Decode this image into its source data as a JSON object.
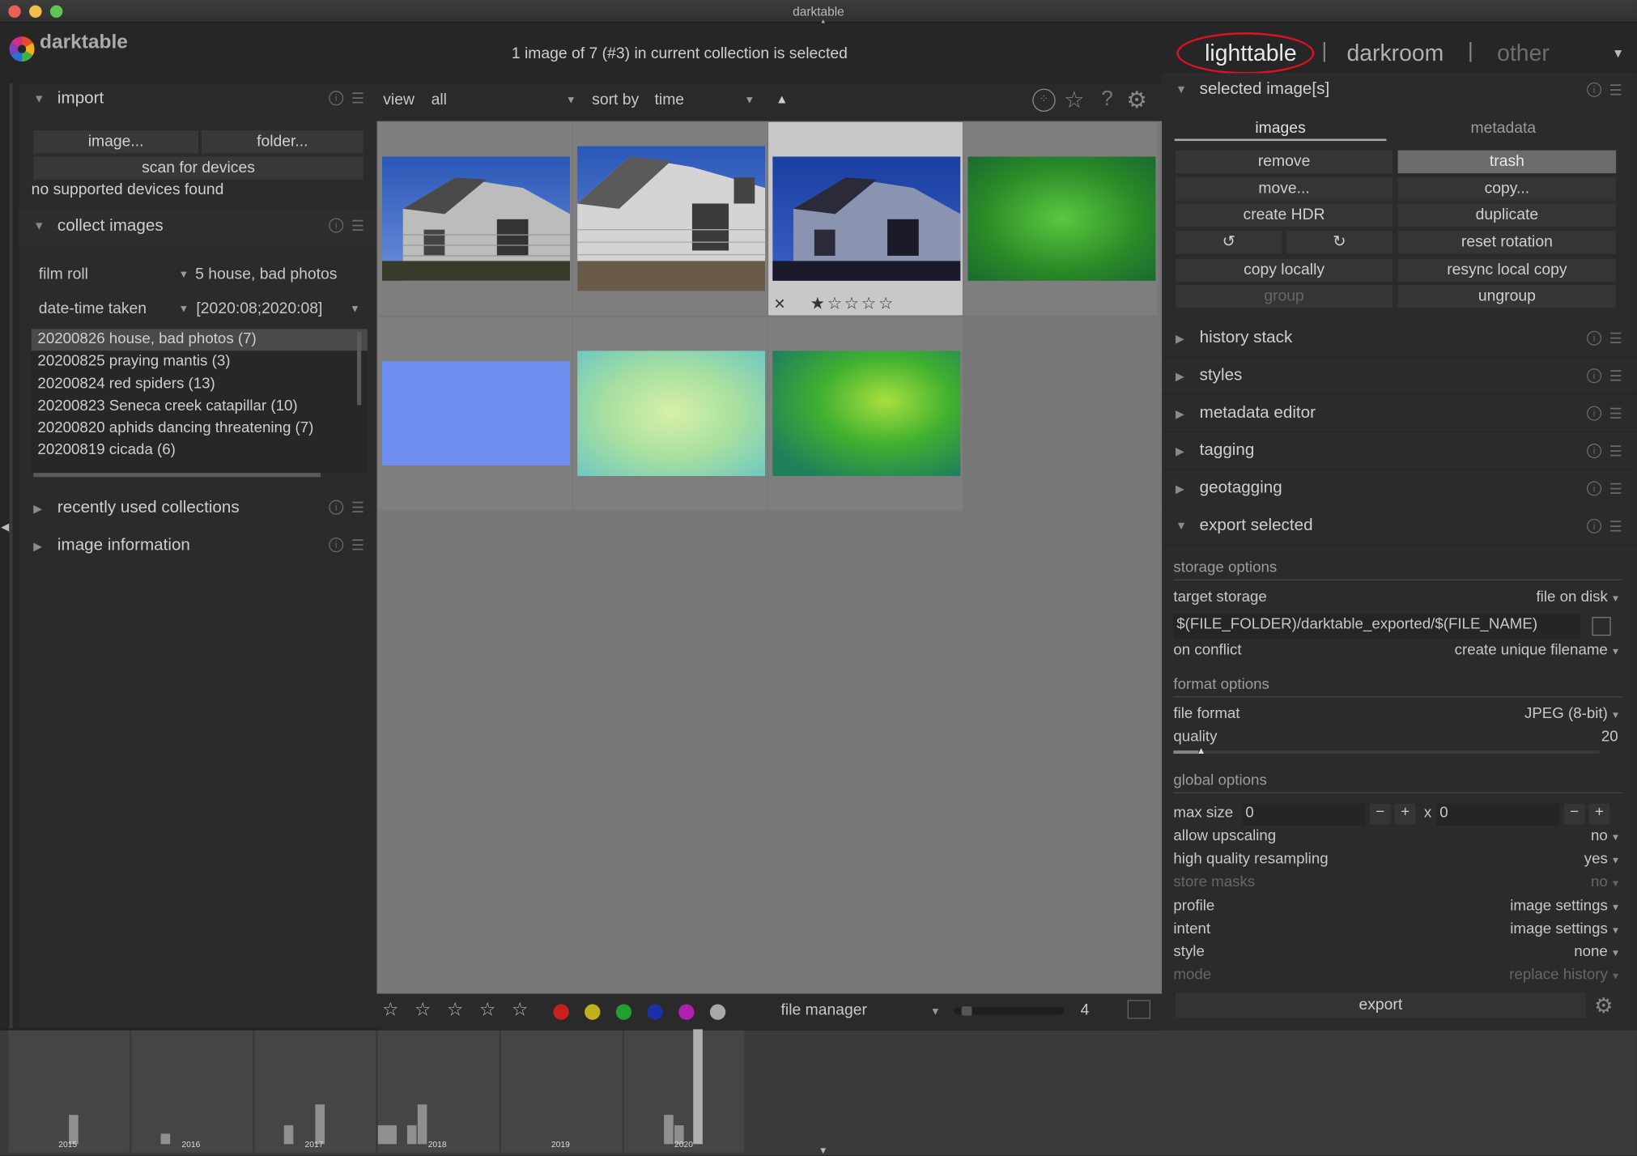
{
  "window": {
    "title": "darktable"
  },
  "app": {
    "name": "darktable"
  },
  "header": {
    "status": "1 image of 7 (#3) in current collection is selected",
    "views": [
      "lighttable",
      "darkroom",
      "other"
    ],
    "separator": "|"
  },
  "left": {
    "import": {
      "title": "import",
      "image_btn": "image...",
      "folder_btn": "folder...",
      "scan_btn": "scan for devices",
      "status": "no supported devices found"
    },
    "collect": {
      "title": "collect images",
      "rule1_key": "film roll",
      "rule1_value": "5 house, bad photos",
      "rule2_key": "date-time taken",
      "rule2_value": "[2020:08;2020:08]",
      "items": [
        "20200826 house, bad photos (7)",
        "20200825 praying mantis (3)",
        "20200824 red spiders (13)",
        "20200823 Seneca creek catapillar (10)",
        "20200820 aphids dancing threatening (7)",
        "20200819 cicada (6)"
      ]
    },
    "recent": {
      "title": "recently used collections"
    },
    "info": {
      "title": "image information"
    }
  },
  "toolbar": {
    "view_label": "view",
    "view_value": "all",
    "sort_label": "sort by",
    "sort_value": "time",
    "sort_dir": "▲"
  },
  "bottombar": {
    "layout": "file manager",
    "zoom": "4",
    "colors": [
      "#c8201e",
      "#c0b020",
      "#20a030",
      "#1a2fa8",
      "#b020b0",
      "#a8a8a8"
    ]
  },
  "right": {
    "selected": {
      "title": "selected image[s]",
      "tab_images": "images",
      "tab_metadata": "metadata",
      "buttons": {
        "remove": "remove",
        "trash": "trash",
        "move": "move...",
        "copy": "copy...",
        "create_hdr": "create HDR",
        "duplicate": "duplicate",
        "reset_rotation": "reset rotation",
        "copy_locally": "copy locally",
        "resync": "resync local copy",
        "group": "group",
        "ungroup": "ungroup"
      }
    },
    "modules": [
      "history stack",
      "styles",
      "metadata editor",
      "tagging",
      "geotagging"
    ],
    "export": {
      "title": "export selected",
      "storage_options": "storage options",
      "target_storage_label": "target storage",
      "target_storage": "file on disk",
      "path": "$(FILE_FOLDER)/darktable_exported/$(FILE_NAME)",
      "on_conflict_label": "on conflict",
      "on_conflict": "create unique filename",
      "format_options": "format options",
      "file_format_label": "file format",
      "file_format": "JPEG (8-bit)",
      "quality_label": "quality",
      "quality": "20",
      "quality_fraction": 0.2,
      "global_options": "global options",
      "max_size_label": "max size",
      "max_w": "0",
      "x": "x",
      "max_h": "0",
      "minus": "−",
      "plus": "+",
      "upscale_label": "allow upscaling",
      "upscale": "no",
      "hq_label": "high quality resampling",
      "hq": "yes",
      "masks_label": "store masks",
      "masks": "no",
      "profile_label": "profile",
      "profile": "image settings",
      "intent_label": "intent",
      "intent": "image settings",
      "style_label": "style",
      "style": "none",
      "mode_label": "mode",
      "mode": "replace history",
      "export_btn": "export"
    }
  },
  "timeline": {
    "years": [
      "2015",
      "2016",
      "2017",
      "2018",
      "2019",
      "2020"
    ]
  }
}
